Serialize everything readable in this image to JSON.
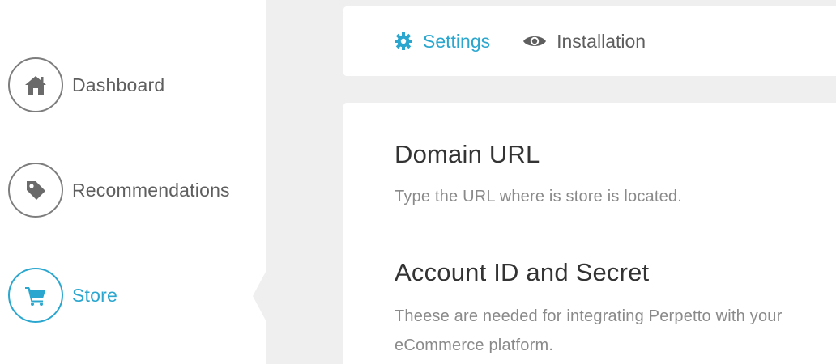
{
  "sidebar": {
    "items": [
      {
        "label": "Dashboard",
        "icon": "home-icon",
        "active": false
      },
      {
        "label": "Recommendations",
        "icon": "tag-icon",
        "active": false
      },
      {
        "label": "Store",
        "icon": "cart-icon",
        "active": true
      }
    ]
  },
  "tabs": [
    {
      "label": "Settings",
      "icon": "gear-icon",
      "active": true
    },
    {
      "label": "Installation",
      "icon": "eye-icon",
      "active": false
    }
  ],
  "content": {
    "sections": [
      {
        "title": "Domain URL",
        "description": "Type the URL where is store is located."
      },
      {
        "title": "Account ID and Secret",
        "description": "Theese are needed for integrating Perpetto with your eCommerce platform."
      }
    ]
  },
  "colors": {
    "accent": "#2ba7cf",
    "muted": "#7d7d7d",
    "background": "#efefef"
  }
}
